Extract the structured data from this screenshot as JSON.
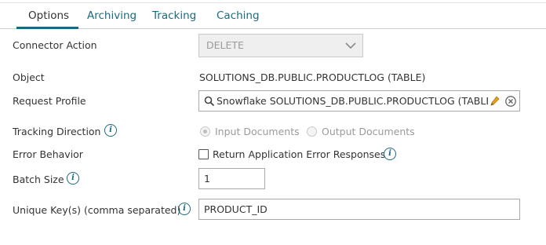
{
  "tabs": [
    {
      "label": "Options",
      "active": true
    },
    {
      "label": "Archiving",
      "active": false
    },
    {
      "label": "Tracking",
      "active": false
    },
    {
      "label": "Caching",
      "active": false
    }
  ],
  "form": {
    "connector_action": {
      "label": "Connector Action",
      "value": "DELETE",
      "disabled": true
    },
    "object": {
      "label": "Object",
      "value": "SOLUTIONS_DB.PUBLIC.PRODUCTLOG (TABLE)"
    },
    "request_profile": {
      "label": "Request Profile",
      "value": "Snowflake SOLUTIONS_DB.PUBLIC.PRODUCTLOG (TABLE"
    },
    "tracking_direction": {
      "label": "Tracking Direction",
      "options": [
        {
          "label": "Input Documents",
          "selected": true
        },
        {
          "label": "Output Documents",
          "selected": false
        }
      ],
      "disabled": true
    },
    "error_behavior": {
      "label": "Error Behavior",
      "checkbox_label": "Return Application Error Responses",
      "checked": false
    },
    "batch_size": {
      "label": "Batch Size",
      "value": "1"
    },
    "unique_keys": {
      "label": "Unique Key(s) (comma separated)",
      "value": "PRODUCT_ID"
    }
  },
  "icons": {
    "info": "i",
    "info_color": "#1a6a7e",
    "search": "search-icon",
    "edit": "pencil-icon",
    "clear": "clear-icon",
    "dropdown": "chevron-down-icon"
  },
  "colors": {
    "accent": "#1a6a7e",
    "text": "#333333",
    "disabled_text": "#9a9a9a"
  }
}
